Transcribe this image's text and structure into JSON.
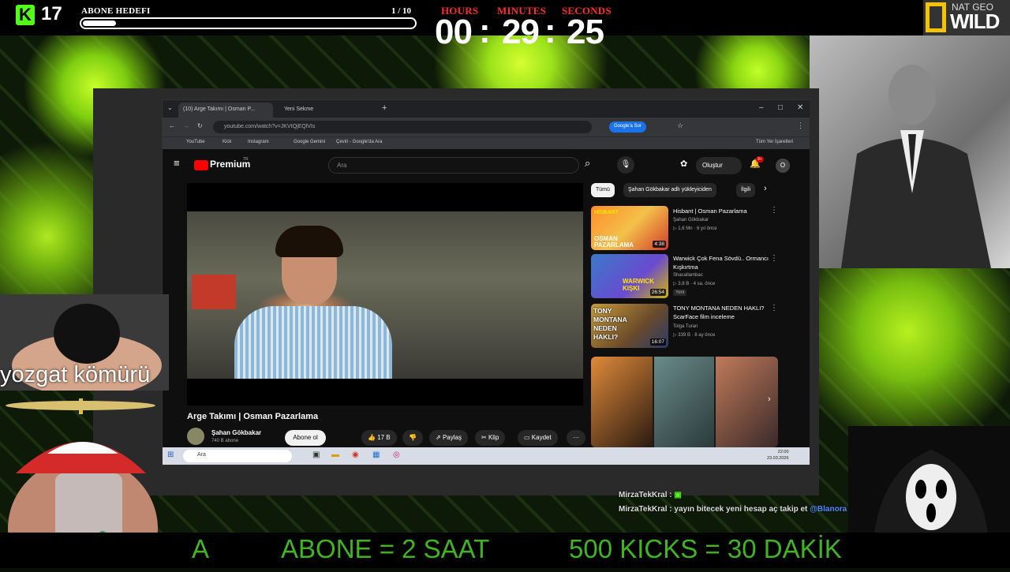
{
  "stream": {
    "kick_count": "17",
    "goal": {
      "label": "ABONE HEDEFI",
      "count": "1 / 10",
      "progress": 0.1
    },
    "timer": {
      "hours_label": "HOURS",
      "minutes_label": "MINUTES",
      "seconds_label": "SECONDS",
      "hours": "00",
      "minutes": "29",
      "seconds": "25",
      "sep": ":"
    },
    "natgeo": {
      "line1": "NAT GEO",
      "line2": "WILD"
    },
    "coal_caption": "yozgat kömürü",
    "chat": [
      {
        "user": "MirzaTekKral :",
        "text": ""
      },
      {
        "user": "MirzaTekKral :",
        "text": "yayın bitecek yeni hesap aç takip et",
        "mention": "@Blanora"
      }
    ],
    "ticker": [
      "A",
      "ABONE = 2 SAAT",
      "500 KICKS = 30 DAKİK"
    ]
  },
  "browser": {
    "tabs": [
      "(10) Arge Takımı | Osman P...",
      "Yeni Sekme"
    ],
    "new_tab": "+",
    "window_controls": [
      "–",
      "□",
      "✕"
    ],
    "url": "youtube.com/watch?v=JKVtQjEQlVIs",
    "google_chip": "Google'a Sor",
    "bookmarks": [
      "YouTube",
      "Kick",
      "Instagram",
      "Google Gemini",
      "Çeviri - Google'da Ara"
    ],
    "all_bookmarks": "Tüm Yer İşaretleri"
  },
  "youtube": {
    "logo": "Premium",
    "logo_sup": "TR",
    "search_placeholder": "Ara",
    "create_label": "Oluştur",
    "notif_count": "9+",
    "avatar_letter": "O",
    "video_title": "Arge Takımı | Osman Pazarlama",
    "channel": "Şahan Gökbakar",
    "subs": "740 B abone",
    "subscribe": "Abone ol",
    "likes": "17 B",
    "share": "Paylaş",
    "clip": "Klip",
    "save": "Kaydet",
    "more": "···",
    "chips": [
      "Tümü",
      "Şahan Gökbakar adlı yükleyiciden",
      "İlgili"
    ],
    "recs": [
      {
        "title": "Hisbant | Osman Pazarlama",
        "channel": "Şahan Gökbakar",
        "meta": "▷ 1,6 Mn · 6 yıl önce",
        "duration": "4:38",
        "thumb_text": "OSMAN PAZARLAMA",
        "thumb_top": "HİSBANT"
      },
      {
        "title": "Warwick Çok Fena Sövdü.. Ormancı Kışkırtma",
        "channel": "Shacallambac",
        "meta": "▷ 3,8 B · 4 sa. önce",
        "duration": "26:54",
        "badge": "Yeni",
        "thumb_text": "WARWICK KIŞKI"
      },
      {
        "title": "TONY MONTANA NEDEN HAKLI? ScarFace film inceleme",
        "channel": "Tolga Turan",
        "meta": "▷ 339 B · 8 ay önce",
        "duration": "16:07",
        "thumb_text": "TONY MONTANA NEDEN HAKLI?"
      }
    ]
  },
  "taskbar": {
    "search": "Ara",
    "time": "22:00",
    "date": "23.03.2026"
  },
  "colors": {
    "kick_green": "#53fc18",
    "timer_label": "#ff2a2a",
    "ticker": "#3fb51f",
    "yt_red": "#ff0000"
  }
}
